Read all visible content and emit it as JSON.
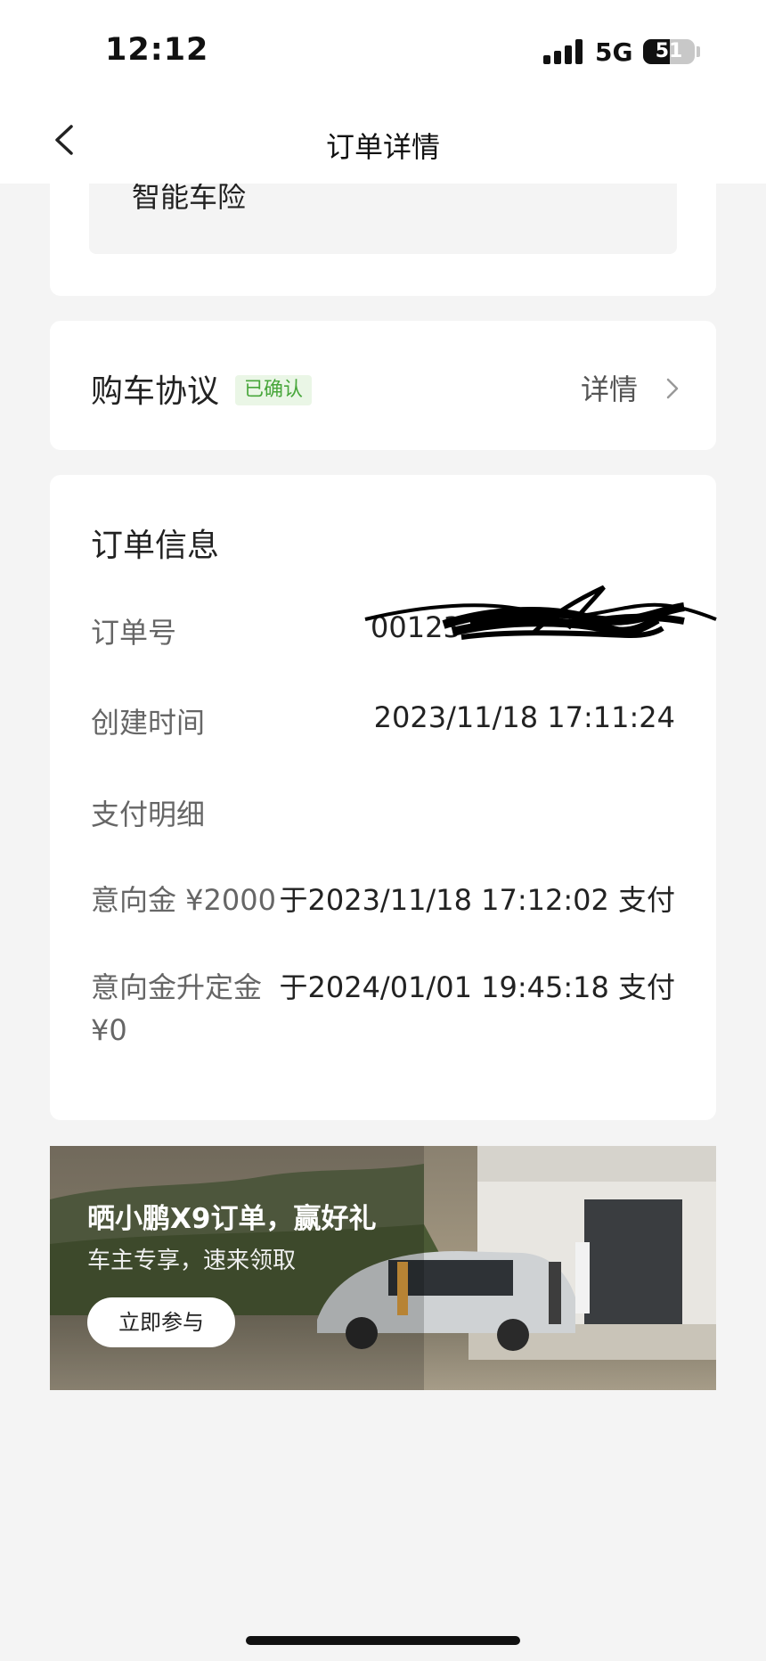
{
  "status_bar": {
    "time": "12:12",
    "network": "5G",
    "battery_percent": "51",
    "battery_level": 0.51
  },
  "nav": {
    "title": "订单详情",
    "back_icon": "chevron-left-icon"
  },
  "insurance": {
    "label": "智能车险"
  },
  "agreement": {
    "title": "购车协议",
    "badge": "已确认",
    "detail_label": "详情",
    "badge_bg": "#eaf6e6",
    "badge_color": "#47a63a"
  },
  "order": {
    "title": "订单信息",
    "order_no_label": "订单号",
    "order_no_value": "00123",
    "created_label": "创建时间",
    "created_value": "2023/11/18 17:11:24",
    "payment_label": "支付明细",
    "payments": [
      {
        "label": "意向金 ¥2000",
        "value": "于2023/11/18 17:12:02 支付"
      },
      {
        "label_line1": "意向金升定金",
        "label_line2": "¥0",
        "value": "于2024/01/01 19:45:18 支付"
      }
    ]
  },
  "banner": {
    "title": "晒小鹏X9订单，赢好礼",
    "subtitle": "车主专享，速来领取",
    "button": "立即参与"
  }
}
